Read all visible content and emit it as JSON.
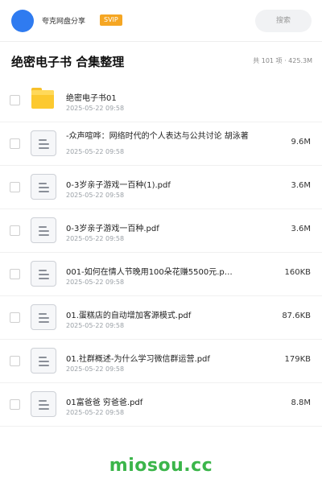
{
  "header": {
    "share_name": "夸克网盘分享",
    "badge": "SVIP",
    "search_placeholder": "搜索",
    "brand_color": "#2f7bf0",
    "badge_color": "#f5a623"
  },
  "title_bar": {
    "title": "绝密电子书 合集整理",
    "summary": "共 101 项 · 425.3M"
  },
  "files": [
    {
      "icon": "folder-icon",
      "name": "绝密电子书01",
      "date": "2025-05-22 09:58",
      "size": ""
    },
    {
      "icon": "doc-icon",
      "name": "-众声喧哗：网络时代的个人表达与公共讨论 胡泳著",
      "date": "2025-05-22 09:58",
      "size": "9.6M"
    },
    {
      "icon": "doc-icon",
      "name": "0-3岁亲子游戏一百种(1).pdf",
      "date": "2025-05-22 09:58",
      "size": "3.6M"
    },
    {
      "icon": "doc-icon",
      "name": "0-3岁亲子游戏一百种.pdf",
      "date": "2025-05-22 09:58",
      "size": "3.6M"
    },
    {
      "icon": "doc-icon",
      "name": "001-如何在情人节晚用100朵花赚5500元.p…",
      "date": "2025-05-22 09:58",
      "size": "160KB"
    },
    {
      "icon": "doc-icon",
      "name": "01.蛋糕店的自动增加客源模式.pdf",
      "date": "2025-05-22 09:58",
      "size": "87.6KB"
    },
    {
      "icon": "doc-icon",
      "name": "01.社群概述-为什么学习微信群运营.pdf",
      "date": "2025-05-22 09:58",
      "size": "179KB"
    },
    {
      "icon": "doc-icon",
      "name": "01富爸爸 穷爸爸.pdf",
      "date": "2025-05-22 09:58",
      "size": "8.8M"
    }
  ],
  "watermark": "miosou.cc",
  "watermark_color": "#3bb54a"
}
